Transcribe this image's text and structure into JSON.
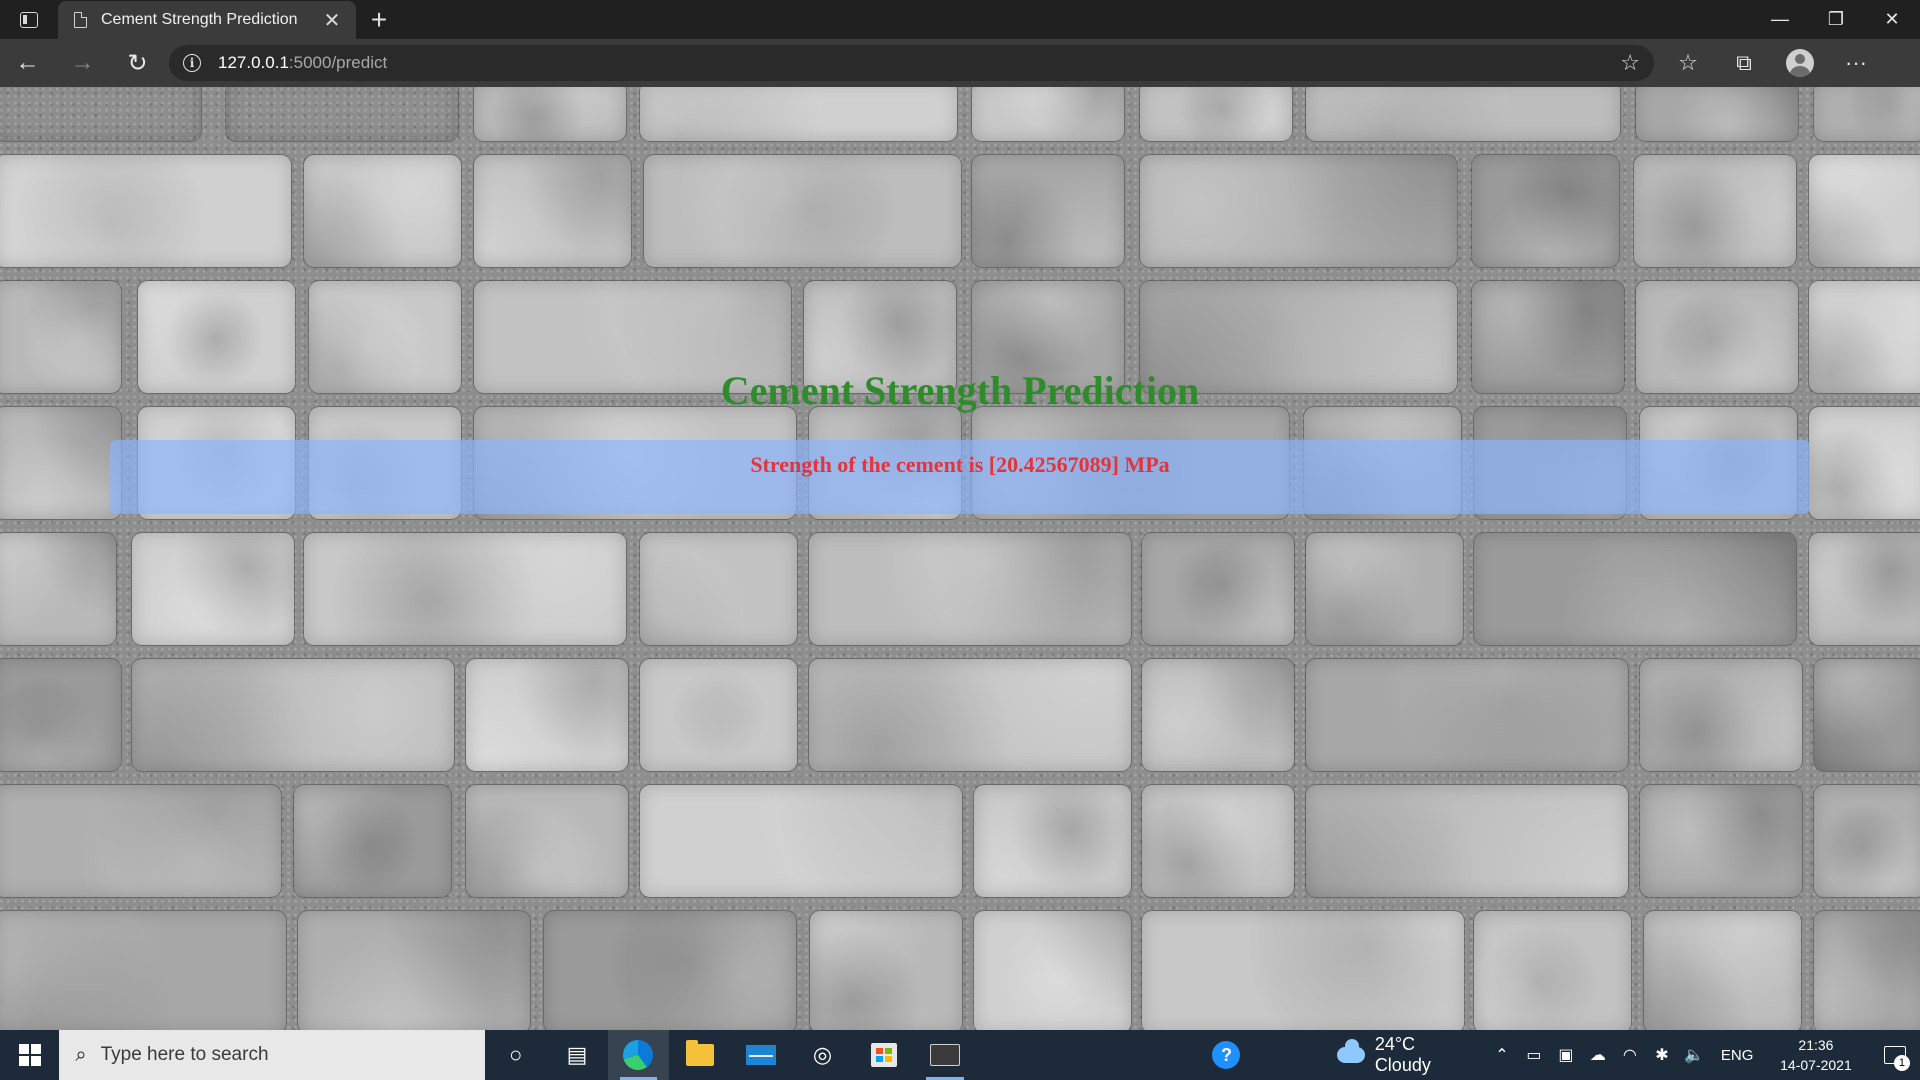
{
  "browser": {
    "tab_title": "Cement Strength Prediction",
    "tab_close": "✕",
    "new_tab": "+",
    "url_host": "127.0.0.1",
    "url_path": ":5000/predict",
    "window": {
      "minimize": "—",
      "restore": "❐",
      "close": "✕"
    },
    "nav": {
      "back": "←",
      "forward": "→",
      "reload": "↻"
    },
    "toolbar": {
      "favorite_add": "☆",
      "favorites": "☆",
      "collections": "⧉",
      "more": "···"
    }
  },
  "page": {
    "title": "Cement Strength Prediction",
    "result": "Strength of the cement is [20.42567089] MPa",
    "colors": {
      "title": "#2f8b2c",
      "result": "#e3343a",
      "band": "#8cb4ff"
    }
  },
  "taskbar": {
    "search_placeholder": "Type here to search",
    "weather": "24°C  Cloudy",
    "language": "ENG",
    "time": "21:36",
    "date": "14-07-2021",
    "notification_count": "1",
    "icons": [
      "cortana-icon",
      "task-view-icon",
      "edge-icon",
      "file-explorer-icon",
      "mail-icon",
      "hp-icon",
      "store-icon",
      "terminal-icon",
      "help-icon"
    ]
  }
}
